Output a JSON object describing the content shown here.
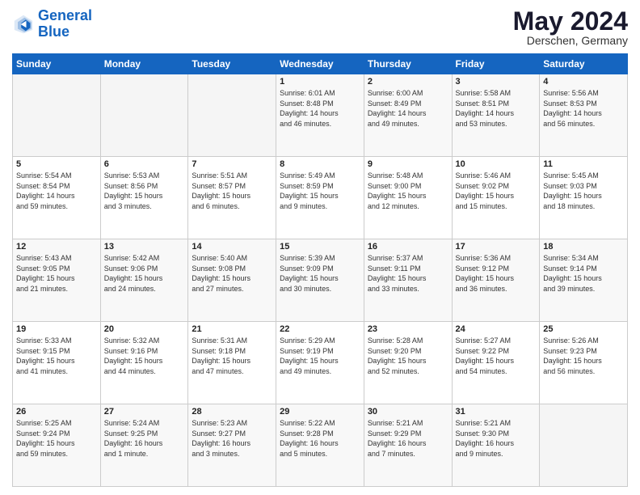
{
  "logo": {
    "line1": "General",
    "line2": "Blue"
  },
  "title": "May 2024",
  "location": "Derschen, Germany",
  "days_of_week": [
    "Sunday",
    "Monday",
    "Tuesday",
    "Wednesday",
    "Thursday",
    "Friday",
    "Saturday"
  ],
  "weeks": [
    [
      {
        "day": "",
        "content": ""
      },
      {
        "day": "",
        "content": ""
      },
      {
        "day": "",
        "content": ""
      },
      {
        "day": "1",
        "content": "Sunrise: 6:01 AM\nSunset: 8:48 PM\nDaylight: 14 hours\nand 46 minutes."
      },
      {
        "day": "2",
        "content": "Sunrise: 6:00 AM\nSunset: 8:49 PM\nDaylight: 14 hours\nand 49 minutes."
      },
      {
        "day": "3",
        "content": "Sunrise: 5:58 AM\nSunset: 8:51 PM\nDaylight: 14 hours\nand 53 minutes."
      },
      {
        "day": "4",
        "content": "Sunrise: 5:56 AM\nSunset: 8:53 PM\nDaylight: 14 hours\nand 56 minutes."
      }
    ],
    [
      {
        "day": "5",
        "content": "Sunrise: 5:54 AM\nSunset: 8:54 PM\nDaylight: 14 hours\nand 59 minutes."
      },
      {
        "day": "6",
        "content": "Sunrise: 5:53 AM\nSunset: 8:56 PM\nDaylight: 15 hours\nand 3 minutes."
      },
      {
        "day": "7",
        "content": "Sunrise: 5:51 AM\nSunset: 8:57 PM\nDaylight: 15 hours\nand 6 minutes."
      },
      {
        "day": "8",
        "content": "Sunrise: 5:49 AM\nSunset: 8:59 PM\nDaylight: 15 hours\nand 9 minutes."
      },
      {
        "day": "9",
        "content": "Sunrise: 5:48 AM\nSunset: 9:00 PM\nDaylight: 15 hours\nand 12 minutes."
      },
      {
        "day": "10",
        "content": "Sunrise: 5:46 AM\nSunset: 9:02 PM\nDaylight: 15 hours\nand 15 minutes."
      },
      {
        "day": "11",
        "content": "Sunrise: 5:45 AM\nSunset: 9:03 PM\nDaylight: 15 hours\nand 18 minutes."
      }
    ],
    [
      {
        "day": "12",
        "content": "Sunrise: 5:43 AM\nSunset: 9:05 PM\nDaylight: 15 hours\nand 21 minutes."
      },
      {
        "day": "13",
        "content": "Sunrise: 5:42 AM\nSunset: 9:06 PM\nDaylight: 15 hours\nand 24 minutes."
      },
      {
        "day": "14",
        "content": "Sunrise: 5:40 AM\nSunset: 9:08 PM\nDaylight: 15 hours\nand 27 minutes."
      },
      {
        "day": "15",
        "content": "Sunrise: 5:39 AM\nSunset: 9:09 PM\nDaylight: 15 hours\nand 30 minutes."
      },
      {
        "day": "16",
        "content": "Sunrise: 5:37 AM\nSunset: 9:11 PM\nDaylight: 15 hours\nand 33 minutes."
      },
      {
        "day": "17",
        "content": "Sunrise: 5:36 AM\nSunset: 9:12 PM\nDaylight: 15 hours\nand 36 minutes."
      },
      {
        "day": "18",
        "content": "Sunrise: 5:34 AM\nSunset: 9:14 PM\nDaylight: 15 hours\nand 39 minutes."
      }
    ],
    [
      {
        "day": "19",
        "content": "Sunrise: 5:33 AM\nSunset: 9:15 PM\nDaylight: 15 hours\nand 41 minutes."
      },
      {
        "day": "20",
        "content": "Sunrise: 5:32 AM\nSunset: 9:16 PM\nDaylight: 15 hours\nand 44 minutes."
      },
      {
        "day": "21",
        "content": "Sunrise: 5:31 AM\nSunset: 9:18 PM\nDaylight: 15 hours\nand 47 minutes."
      },
      {
        "day": "22",
        "content": "Sunrise: 5:29 AM\nSunset: 9:19 PM\nDaylight: 15 hours\nand 49 minutes."
      },
      {
        "day": "23",
        "content": "Sunrise: 5:28 AM\nSunset: 9:20 PM\nDaylight: 15 hours\nand 52 minutes."
      },
      {
        "day": "24",
        "content": "Sunrise: 5:27 AM\nSunset: 9:22 PM\nDaylight: 15 hours\nand 54 minutes."
      },
      {
        "day": "25",
        "content": "Sunrise: 5:26 AM\nSunset: 9:23 PM\nDaylight: 15 hours\nand 56 minutes."
      }
    ],
    [
      {
        "day": "26",
        "content": "Sunrise: 5:25 AM\nSunset: 9:24 PM\nDaylight: 15 hours\nand 59 minutes."
      },
      {
        "day": "27",
        "content": "Sunrise: 5:24 AM\nSunset: 9:25 PM\nDaylight: 16 hours\nand 1 minute."
      },
      {
        "day": "28",
        "content": "Sunrise: 5:23 AM\nSunset: 9:27 PM\nDaylight: 16 hours\nand 3 minutes."
      },
      {
        "day": "29",
        "content": "Sunrise: 5:22 AM\nSunset: 9:28 PM\nDaylight: 16 hours\nand 5 minutes."
      },
      {
        "day": "30",
        "content": "Sunrise: 5:21 AM\nSunset: 9:29 PM\nDaylight: 16 hours\nand 7 minutes."
      },
      {
        "day": "31",
        "content": "Sunrise: 5:21 AM\nSunset: 9:30 PM\nDaylight: 16 hours\nand 9 minutes."
      },
      {
        "day": "",
        "content": ""
      }
    ]
  ]
}
